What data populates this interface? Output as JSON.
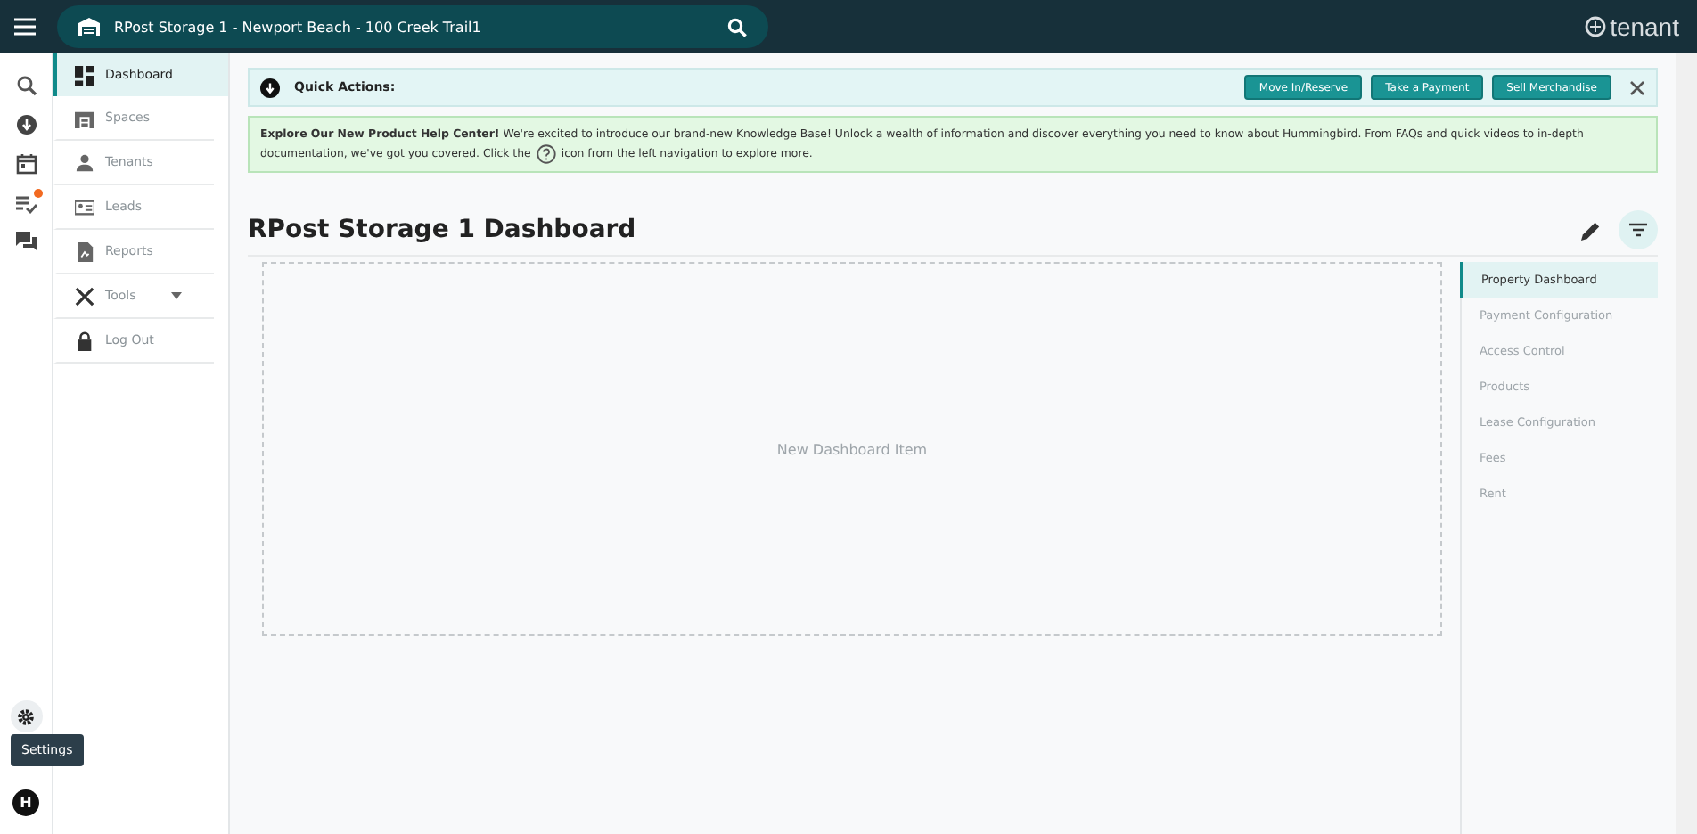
{
  "top_bar": {
    "property": "RPost Storage 1 - Newport Beach - 100  Creek Trail1",
    "logo": "tenant"
  },
  "rail": [
    {
      "notification": false
    },
    {
      "notification": false
    },
    {
      "notification": false
    },
    {
      "notification": true
    },
    {
      "notification": false
    }
  ],
  "tooltip": "Settings",
  "avatar": "H",
  "nav": [
    {
      "label": "Dashboard",
      "selected": true,
      "kind": "link"
    },
    {
      "label": "Spaces",
      "selected": false,
      "kind": "link"
    },
    {
      "label": "Tenants",
      "selected": false,
      "kind": "link"
    },
    {
      "label": "Leads",
      "selected": false,
      "kind": "link"
    },
    {
      "label": "Reports",
      "selected": false,
      "kind": "link"
    },
    {
      "label": "Tools",
      "selected": false,
      "kind": "menu"
    },
    {
      "label": "Log Out",
      "selected": false,
      "kind": "link"
    }
  ],
  "quick_actions": {
    "label": "Quick Actions:",
    "buttons": [
      "Move In/Reserve",
      "Take a Payment",
      "Sell Merchandise"
    ]
  },
  "help_banner": {
    "line_1": "**Explore Our New Product Help Center!**  We're excited to introduce our brand-new Knowledge Base! Unlock a wealth of information and discover everything you need to know about Hummingbird. From FAQs and quick videos to in-depth",
    "before_icon": "documentation, we've got you covered. Click the",
    "after_icon": "icon from the left navigation to explore more."
  },
  "title": "RPost Storage 1 Dashboard",
  "dashboard_placeholder": "New Dashboard Item",
  "settings_nav": [
    {
      "label": "Property Dashboard",
      "selected": true
    },
    {
      "label": "Payment Configuration",
      "selected": false
    },
    {
      "label": "Access Control",
      "selected": false
    },
    {
      "label": "Products",
      "selected": false
    },
    {
      "label": "Lease Configuration",
      "selected": false
    },
    {
      "label": "Fees",
      "selected": false
    },
    {
      "label": "Rent",
      "selected": false
    }
  ]
}
